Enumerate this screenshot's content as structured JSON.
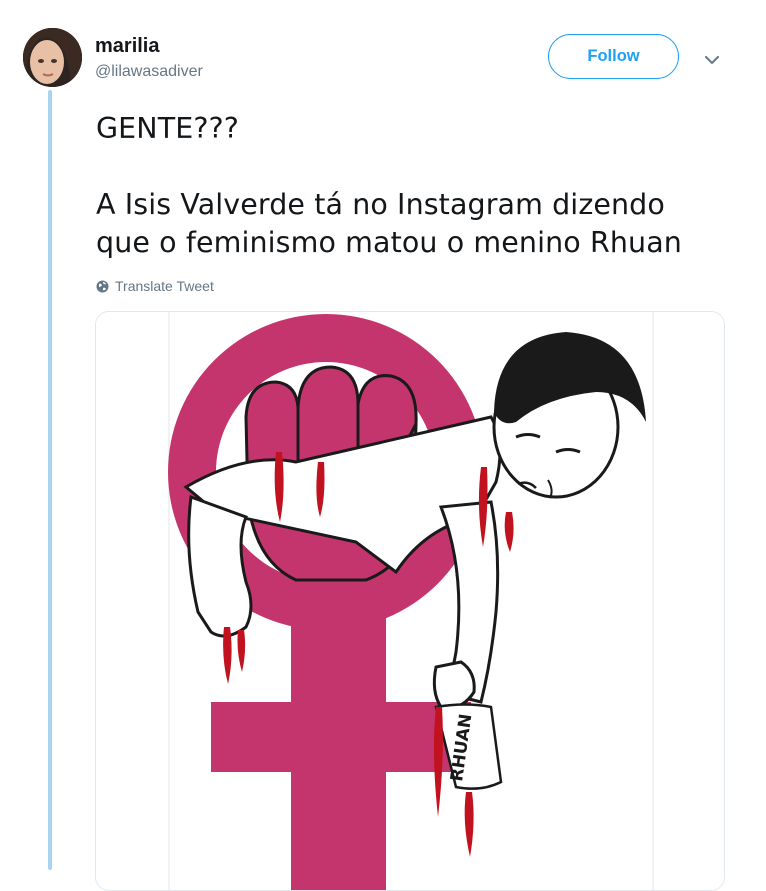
{
  "tweet": {
    "author_name": "marilia",
    "author_handle": "@lilawasadiver",
    "follow_label": "Follow",
    "text": "GENTE???\n\nA Isis Valverde tá no Instagram dizendo\nque o feminismo matou o menino Rhuan",
    "translate_label": "Translate Tweet"
  },
  "media": {
    "banner_text": "RHUAN",
    "colors": {
      "magenta": "#c5356d",
      "blood": "#c1121f",
      "ink": "#1a1a1a"
    }
  },
  "colors": {
    "accent": "#1da1f2",
    "muted": "#657786",
    "thread_line": "#a8d4f2"
  },
  "icons": [
    "avatar",
    "chevron-down-icon",
    "globe-icon"
  ]
}
